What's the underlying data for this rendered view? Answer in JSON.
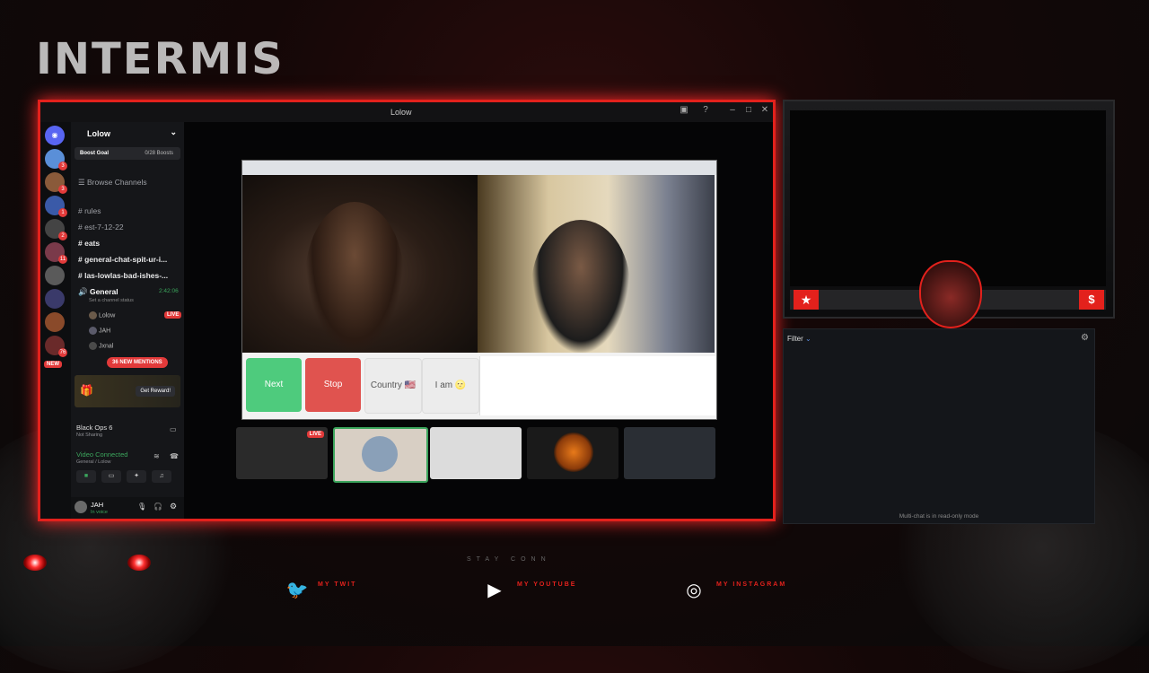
{
  "overlay": {
    "title_word": "INTERMIS",
    "stay_text": "STAY CONN",
    "socials": [
      {
        "icon": "twitter-icon",
        "label": "MY TWIT"
      },
      {
        "icon": "youtube-icon",
        "label": "MY YOUTUBE"
      },
      {
        "icon": "instagram-icon",
        "label": "MY INSTAGRAM"
      }
    ],
    "accent_color": "#e3211c"
  },
  "discord": {
    "window_title": "Lolow",
    "server_name": "Lolow",
    "boost_goal_label": "Boost Goal",
    "boost_count": "0/28 Boosts",
    "browse_channels": "Browse Channels",
    "channels": [
      "rules",
      "est-7-12-22",
      "eats",
      "general-chat-spit-ur-i...",
      "las-lowlas-bad-ishes-..."
    ],
    "voice_channel": "General",
    "voice_timer": "2:42:06",
    "channel_status_hint": "Set a channel status",
    "voice_users": [
      "Lolow",
      "JAH",
      "Jxnal"
    ],
    "live_label": "LIVE",
    "mentions_label": "36 NEW MENTIONS",
    "new_label": "NEW",
    "reward_button": "Get Reward!",
    "activity_title": "Black Ops 6",
    "activity_sub": "Not Sharing",
    "connection_status": "Video Connected",
    "connection_sub": "General / Lolow",
    "user_name": "JAH",
    "user_status": "In voice",
    "server_badges": [
      "3",
      "3",
      "1",
      "2",
      "11",
      "76"
    ]
  },
  "video_chat": {
    "buttons": {
      "next": "Next",
      "stop": "Stop",
      "country": "Country 🇺🇸",
      "iam": "I am 🌝"
    },
    "thumb_live": "LIVE"
  },
  "right_panel": {
    "filter_label": "Filter",
    "readonly_notice": "Multi-chat is in read-only mode"
  }
}
